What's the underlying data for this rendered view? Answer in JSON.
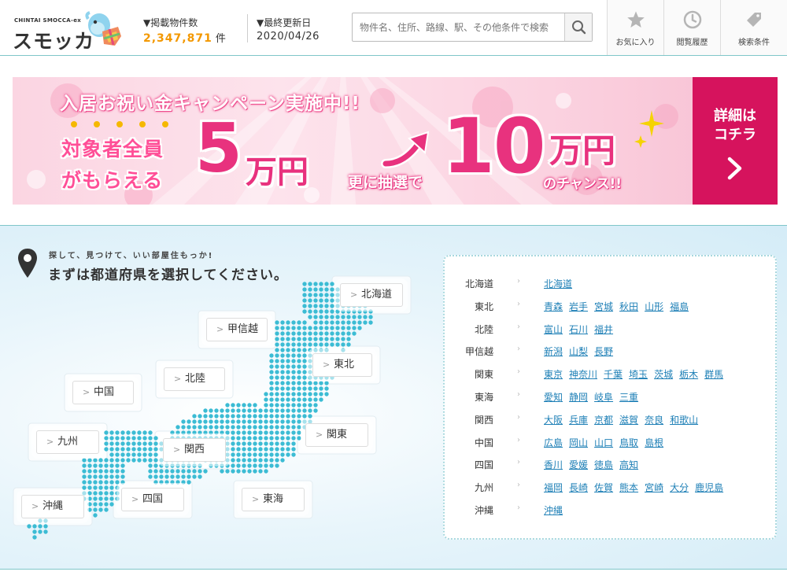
{
  "header": {
    "logo_sub": "CHINTAI SMOCCA-ex",
    "logo_main": "スモッカ",
    "listing_label": "▼掲載物件数",
    "listing_count": "2,347,871",
    "listing_unit": "件",
    "update_label": "▼最終更新日",
    "update_date": "2020/04/26",
    "search_placeholder": "物件名、住所、路線、駅、その他条件で検索",
    "buttons": [
      {
        "label": "お気に入り",
        "icon": "star-icon"
      },
      {
        "label": "閲覧履歴",
        "icon": "clock-icon"
      },
      {
        "label": "検索条件",
        "icon": "tag-icon"
      }
    ]
  },
  "banner": {
    "title": "入居お祝い金キャンペーン実施中!!",
    "line1": "対象者全員",
    "line2": "がもらえる",
    "amount1": "5",
    "unit": "万円",
    "lottery": "更に抽選で",
    "amount2": "10",
    "chance": "のチャンス!!",
    "cta": [
      "詳細は",
      "コチラ"
    ],
    "colors": {
      "accent": "#e8327e",
      "cta_bg": "#d6135d"
    }
  },
  "prefecture_section": {
    "tagline": "探して、見つけて、いい部屋住もっか!",
    "heading": "まずは都道府県を選択してください。",
    "map_regions": [
      "北海道",
      "甲信越",
      "東北",
      "中国",
      "北陸",
      "九州",
      "関西",
      "関東",
      "沖縄",
      "四国",
      "東海"
    ],
    "regions": [
      {
        "name": "北海道",
        "prefs": [
          "北海道"
        ]
      },
      {
        "name": "東北",
        "prefs": [
          "青森",
          "岩手",
          "宮城",
          "秋田",
          "山形",
          "福島"
        ]
      },
      {
        "name": "北陸",
        "prefs": [
          "富山",
          "石川",
          "福井"
        ]
      },
      {
        "name": "甲信越",
        "prefs": [
          "新潟",
          "山梨",
          "長野"
        ]
      },
      {
        "name": "関東",
        "prefs": [
          "東京",
          "神奈川",
          "千葉",
          "埼玉",
          "茨城",
          "栃木",
          "群馬"
        ]
      },
      {
        "name": "東海",
        "prefs": [
          "愛知",
          "静岡",
          "岐阜",
          "三重"
        ]
      },
      {
        "name": "関西",
        "prefs": [
          "大阪",
          "兵庫",
          "京都",
          "滋賀",
          "奈良",
          "和歌山"
        ]
      },
      {
        "name": "中国",
        "prefs": [
          "広島",
          "岡山",
          "山口",
          "鳥取",
          "島根"
        ]
      },
      {
        "name": "四国",
        "prefs": [
          "香川",
          "愛媛",
          "徳島",
          "高知"
        ]
      },
      {
        "name": "九州",
        "prefs": [
          "福岡",
          "長崎",
          "佐賀",
          "熊本",
          "宮崎",
          "大分",
          "鹿児島"
        ]
      },
      {
        "name": "沖縄",
        "prefs": [
          "沖縄"
        ]
      }
    ],
    "map_dot_color": "#3cbcd4",
    "link_color": "#1d7fb6"
  }
}
